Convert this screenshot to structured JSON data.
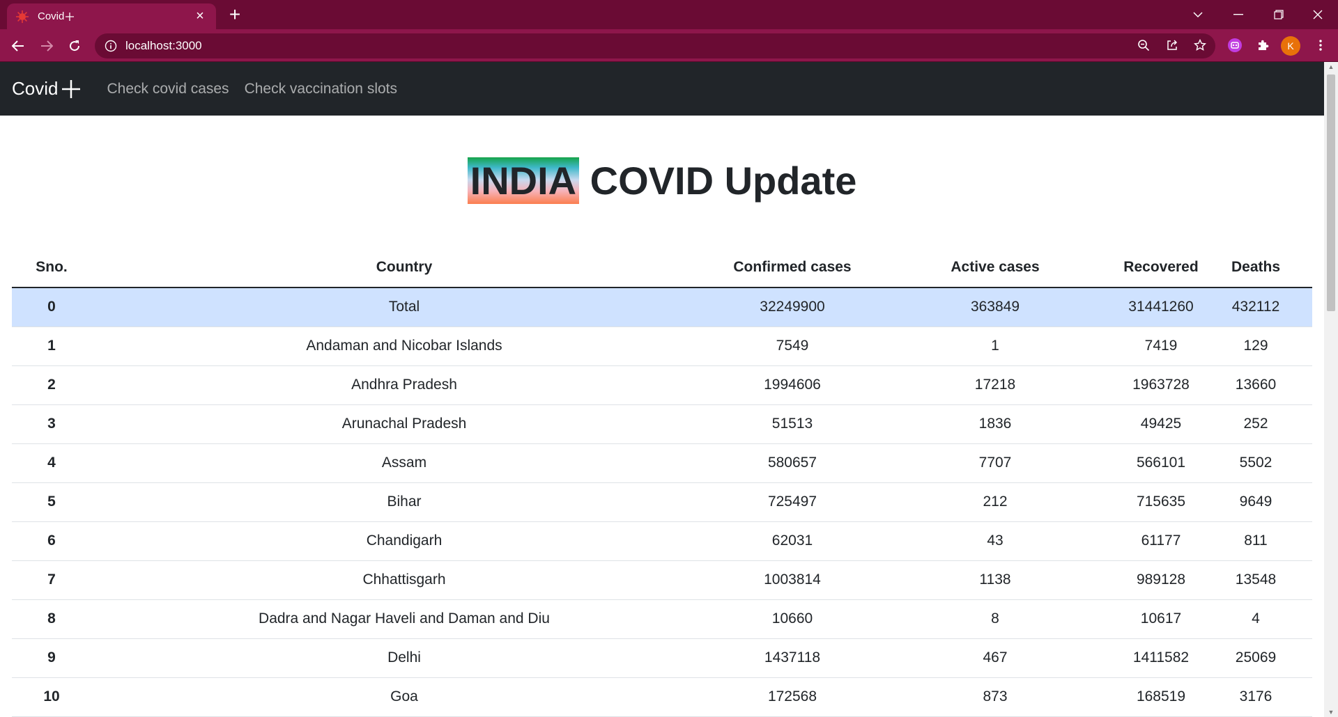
{
  "browser": {
    "tab_title": "Covid",
    "address": "localhost:3000",
    "profile_initial": "K"
  },
  "app": {
    "brand": "Covid",
    "nav": [
      "Check covid cases",
      "Check vaccination slots"
    ]
  },
  "page": {
    "heading_highlight": "INDIA",
    "heading_rest": " COVID Update"
  },
  "table": {
    "headers": [
      "Sno.",
      "Country",
      "Confirmed cases",
      "Active cases",
      "Recovered",
      "Deaths"
    ],
    "rows": [
      [
        "0",
        "Total",
        "32249900",
        "363849",
        "31441260",
        "432112"
      ],
      [
        "1",
        "Andaman and Nicobar Islands",
        "7549",
        "1",
        "7419",
        "129"
      ],
      [
        "2",
        "Andhra Pradesh",
        "1994606",
        "17218",
        "1963728",
        "13660"
      ],
      [
        "3",
        "Arunachal Pradesh",
        "51513",
        "1836",
        "49425",
        "252"
      ],
      [
        "4",
        "Assam",
        "580657",
        "7707",
        "566101",
        "5502"
      ],
      [
        "5",
        "Bihar",
        "725497",
        "212",
        "715635",
        "9649"
      ],
      [
        "6",
        "Chandigarh",
        "62031",
        "43",
        "61177",
        "811"
      ],
      [
        "7",
        "Chhattisgarh",
        "1003814",
        "1138",
        "989128",
        "13548"
      ],
      [
        "8",
        "Dadra and Nagar Haveli and Daman and Diu",
        "10660",
        "8",
        "10617",
        "4"
      ],
      [
        "9",
        "Delhi",
        "1437118",
        "467",
        "1411582",
        "25069"
      ],
      [
        "10",
        "Goa",
        "172568",
        "873",
        "168519",
        "3176"
      ]
    ]
  },
  "colors": {
    "tabbar": "#6a0b34",
    "toolbar": "#8e164b",
    "navbar": "#212529",
    "total_row": "#cfe2ff"
  }
}
